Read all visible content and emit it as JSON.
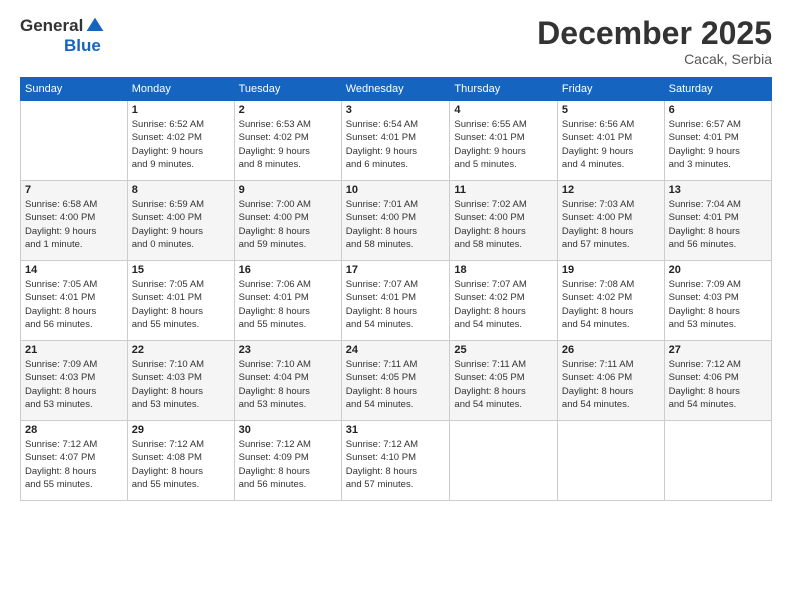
{
  "logo": {
    "general": "General",
    "blue": "Blue"
  },
  "header": {
    "month": "December 2025",
    "location": "Cacak, Serbia"
  },
  "days_of_week": [
    "Sunday",
    "Monday",
    "Tuesday",
    "Wednesday",
    "Thursday",
    "Friday",
    "Saturday"
  ],
  "weeks": [
    [
      {
        "day": "",
        "info": ""
      },
      {
        "day": "1",
        "info": "Sunrise: 6:52 AM\nSunset: 4:02 PM\nDaylight: 9 hours\nand 9 minutes."
      },
      {
        "day": "2",
        "info": "Sunrise: 6:53 AM\nSunset: 4:02 PM\nDaylight: 9 hours\nand 8 minutes."
      },
      {
        "day": "3",
        "info": "Sunrise: 6:54 AM\nSunset: 4:01 PM\nDaylight: 9 hours\nand 6 minutes."
      },
      {
        "day": "4",
        "info": "Sunrise: 6:55 AM\nSunset: 4:01 PM\nDaylight: 9 hours\nand 5 minutes."
      },
      {
        "day": "5",
        "info": "Sunrise: 6:56 AM\nSunset: 4:01 PM\nDaylight: 9 hours\nand 4 minutes."
      },
      {
        "day": "6",
        "info": "Sunrise: 6:57 AM\nSunset: 4:01 PM\nDaylight: 9 hours\nand 3 minutes."
      }
    ],
    [
      {
        "day": "7",
        "info": "Sunrise: 6:58 AM\nSunset: 4:00 PM\nDaylight: 9 hours\nand 1 minute."
      },
      {
        "day": "8",
        "info": "Sunrise: 6:59 AM\nSunset: 4:00 PM\nDaylight: 9 hours\nand 0 minutes."
      },
      {
        "day": "9",
        "info": "Sunrise: 7:00 AM\nSunset: 4:00 PM\nDaylight: 8 hours\nand 59 minutes."
      },
      {
        "day": "10",
        "info": "Sunrise: 7:01 AM\nSunset: 4:00 PM\nDaylight: 8 hours\nand 58 minutes."
      },
      {
        "day": "11",
        "info": "Sunrise: 7:02 AM\nSunset: 4:00 PM\nDaylight: 8 hours\nand 58 minutes."
      },
      {
        "day": "12",
        "info": "Sunrise: 7:03 AM\nSunset: 4:00 PM\nDaylight: 8 hours\nand 57 minutes."
      },
      {
        "day": "13",
        "info": "Sunrise: 7:04 AM\nSunset: 4:01 PM\nDaylight: 8 hours\nand 56 minutes."
      }
    ],
    [
      {
        "day": "14",
        "info": "Sunrise: 7:05 AM\nSunset: 4:01 PM\nDaylight: 8 hours\nand 56 minutes."
      },
      {
        "day": "15",
        "info": "Sunrise: 7:05 AM\nSunset: 4:01 PM\nDaylight: 8 hours\nand 55 minutes."
      },
      {
        "day": "16",
        "info": "Sunrise: 7:06 AM\nSunset: 4:01 PM\nDaylight: 8 hours\nand 55 minutes."
      },
      {
        "day": "17",
        "info": "Sunrise: 7:07 AM\nSunset: 4:01 PM\nDaylight: 8 hours\nand 54 minutes."
      },
      {
        "day": "18",
        "info": "Sunrise: 7:07 AM\nSunset: 4:02 PM\nDaylight: 8 hours\nand 54 minutes."
      },
      {
        "day": "19",
        "info": "Sunrise: 7:08 AM\nSunset: 4:02 PM\nDaylight: 8 hours\nand 54 minutes."
      },
      {
        "day": "20",
        "info": "Sunrise: 7:09 AM\nSunset: 4:03 PM\nDaylight: 8 hours\nand 53 minutes."
      }
    ],
    [
      {
        "day": "21",
        "info": "Sunrise: 7:09 AM\nSunset: 4:03 PM\nDaylight: 8 hours\nand 53 minutes."
      },
      {
        "day": "22",
        "info": "Sunrise: 7:10 AM\nSunset: 4:03 PM\nDaylight: 8 hours\nand 53 minutes."
      },
      {
        "day": "23",
        "info": "Sunrise: 7:10 AM\nSunset: 4:04 PM\nDaylight: 8 hours\nand 53 minutes."
      },
      {
        "day": "24",
        "info": "Sunrise: 7:11 AM\nSunset: 4:05 PM\nDaylight: 8 hours\nand 54 minutes."
      },
      {
        "day": "25",
        "info": "Sunrise: 7:11 AM\nSunset: 4:05 PM\nDaylight: 8 hours\nand 54 minutes."
      },
      {
        "day": "26",
        "info": "Sunrise: 7:11 AM\nSunset: 4:06 PM\nDaylight: 8 hours\nand 54 minutes."
      },
      {
        "day": "27",
        "info": "Sunrise: 7:12 AM\nSunset: 4:06 PM\nDaylight: 8 hours\nand 54 minutes."
      }
    ],
    [
      {
        "day": "28",
        "info": "Sunrise: 7:12 AM\nSunset: 4:07 PM\nDaylight: 8 hours\nand 55 minutes."
      },
      {
        "day": "29",
        "info": "Sunrise: 7:12 AM\nSunset: 4:08 PM\nDaylight: 8 hours\nand 55 minutes."
      },
      {
        "day": "30",
        "info": "Sunrise: 7:12 AM\nSunset: 4:09 PM\nDaylight: 8 hours\nand 56 minutes."
      },
      {
        "day": "31",
        "info": "Sunrise: 7:12 AM\nSunset: 4:10 PM\nDaylight: 8 hours\nand 57 minutes."
      },
      {
        "day": "",
        "info": ""
      },
      {
        "day": "",
        "info": ""
      },
      {
        "day": "",
        "info": ""
      }
    ]
  ]
}
